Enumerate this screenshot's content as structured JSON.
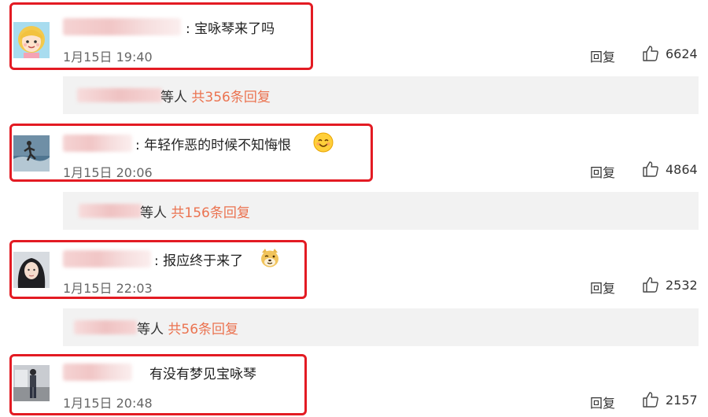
{
  "comments": [
    {
      "text": "宝咏琴来了吗",
      "time": "1月15日 19:40",
      "reply_label": "回复",
      "likes": "6624",
      "reply_summary": {
        "prefix": "等人",
        "link": "共356条回复"
      }
    },
    {
      "text": "年轻作恶的时候不知悔恨",
      "time": "1月15日 20:06",
      "reply_label": "回复",
      "likes": "4864",
      "reply_summary": {
        "prefix": "等人",
        "link": "共156条回复"
      }
    },
    {
      "text": "报应终于来了",
      "time": "1月15日 22:03",
      "reply_label": "回复",
      "likes": "2532",
      "reply_summary": {
        "prefix": "等人",
        "link": "共56条回复"
      }
    },
    {
      "text": "有没有梦见宝咏琴",
      "time": "1月15日 20:48",
      "reply_label": "回复",
      "likes": "2157"
    }
  ],
  "colors": {
    "highlight": "#e31b23",
    "link": "#eb7350",
    "subbar_bg": "#f2f2f2"
  }
}
